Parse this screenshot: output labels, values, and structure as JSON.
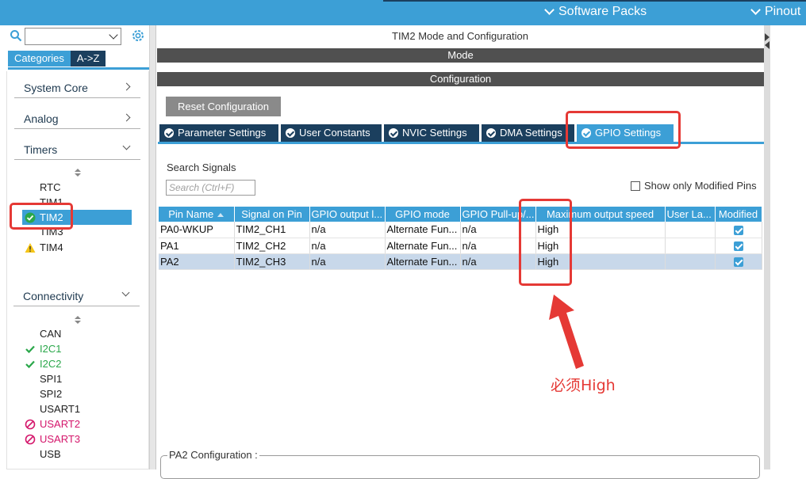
{
  "topbar": {
    "menus": [
      {
        "label": "Software Packs",
        "icon": "chevron-down-icon"
      },
      {
        "label": "Pinout",
        "icon": "chevron-down-icon"
      }
    ]
  },
  "left": {
    "tabs": [
      "Categories",
      "A->Z"
    ],
    "categories": {
      "system_core": "System Core",
      "analog": "Analog",
      "timers": "Timers",
      "connectivity": "Connectivity"
    },
    "timers": [
      "RTC",
      "TIM1",
      "TIM2",
      "TIM3",
      "TIM4"
    ],
    "connectivity": [
      "CAN",
      "I2C1",
      "I2C2",
      "SPI1",
      "SPI2",
      "USART1",
      "USART2",
      "USART3",
      "USB"
    ]
  },
  "main": {
    "title": "TIM2 Mode and Configuration",
    "mode_label": "Mode",
    "configuration_label": "Configuration",
    "reset_button": "Reset Configuration",
    "tabs": [
      "Parameter Settings",
      "User Constants",
      "NVIC Settings",
      "DMA Settings",
      "GPIO Settings"
    ],
    "search_label": "Search Signals",
    "search_placeholder": "Search (Ctrl+F)",
    "show_modified_label": "Show only Modified Pins",
    "table": {
      "headers": [
        "Pin Name",
        "Signal on Pin",
        "GPIO output l...",
        "GPIO mode",
        "GPIO Pull-up/...",
        "Maximum output speed",
        "User La...",
        "Modified"
      ],
      "rows": [
        [
          "PA0-WKUP",
          "TIM2_CH1",
          "n/a",
          "Alternate Fun...",
          "n/a",
          "High",
          "",
          true
        ],
        [
          "PA1",
          "TIM2_CH2",
          "n/a",
          "Alternate Fun...",
          "n/a",
          "High",
          "",
          true
        ],
        [
          "PA2",
          "TIM2_CH3",
          "n/a",
          "Alternate Fun...",
          "n/a",
          "High",
          "",
          true
        ]
      ],
      "selected_row": 2
    },
    "pa2_config_label": "PA2 Configuration :"
  },
  "annotation": {
    "text": "必须High",
    "color": "#e53935"
  },
  "colors": {
    "accent": "#3c9fd6",
    "dark_tab": "#1b3f5e",
    "section_bar": "#505050",
    "ok_green": "#2aa74a",
    "error_magenta": "#d4166b",
    "warning_yellow": "#f5c518"
  }
}
